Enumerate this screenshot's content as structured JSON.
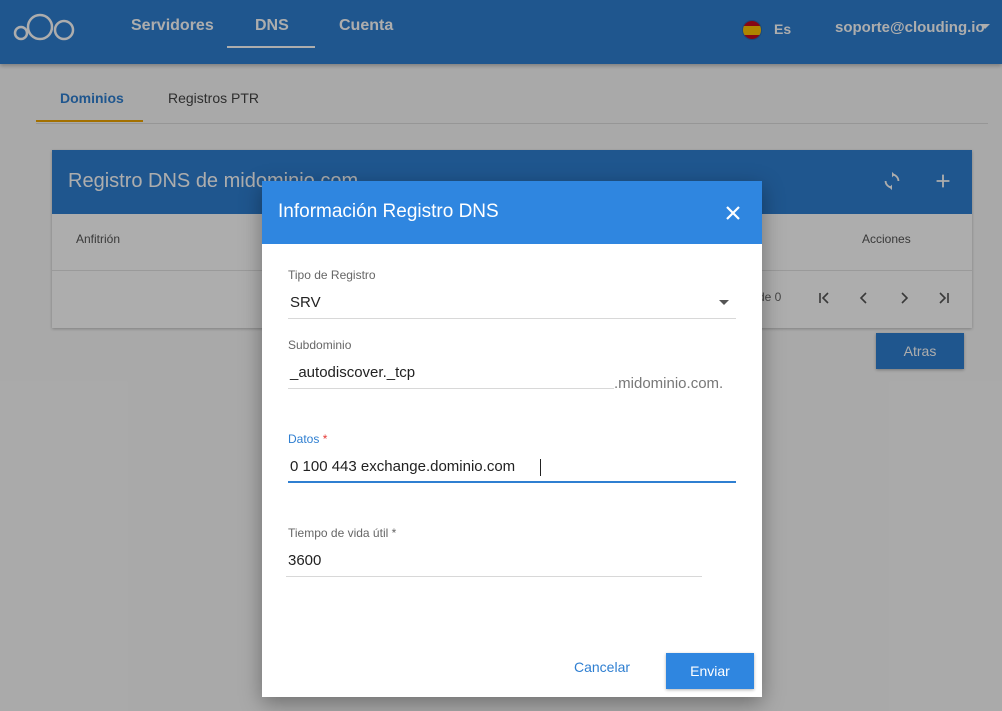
{
  "nav": {
    "items": [
      {
        "label": "Servidores"
      },
      {
        "label": "DNS"
      },
      {
        "label": "Cuenta"
      }
    ],
    "language": "Es",
    "user": "soporte@clouding.io"
  },
  "subtabs": [
    {
      "label": "Dominios"
    },
    {
      "label": "Registros PTR"
    }
  ],
  "card": {
    "title": "Registro DNS de midominio.com",
    "columns": [
      "Anfitrión",
      "Acciones"
    ],
    "pagination_text": "de 0",
    "back_label": "Atras"
  },
  "dialog": {
    "title": "Información Registro DNS",
    "fields": {
      "type": {
        "label": "Tipo de Registro",
        "value": "SRV"
      },
      "subdomain": {
        "label": "Subdominio",
        "value": "_autodiscover._tcp",
        "suffix": ".midominio.com."
      },
      "data": {
        "label": "Datos",
        "required_mark": "*",
        "value": "0 100 443 exchange.dominio.com"
      },
      "ttl": {
        "label": "Tiempo de vida útil",
        "required_mark": "*",
        "value": "3600"
      }
    },
    "cancel_label": "Cancelar",
    "submit_label": "Enviar"
  },
  "colors": {
    "primary": "#2f7fd1",
    "dialog_header": "#2f86e0",
    "tab_accent": "#f0a500",
    "required": "#e53935"
  }
}
